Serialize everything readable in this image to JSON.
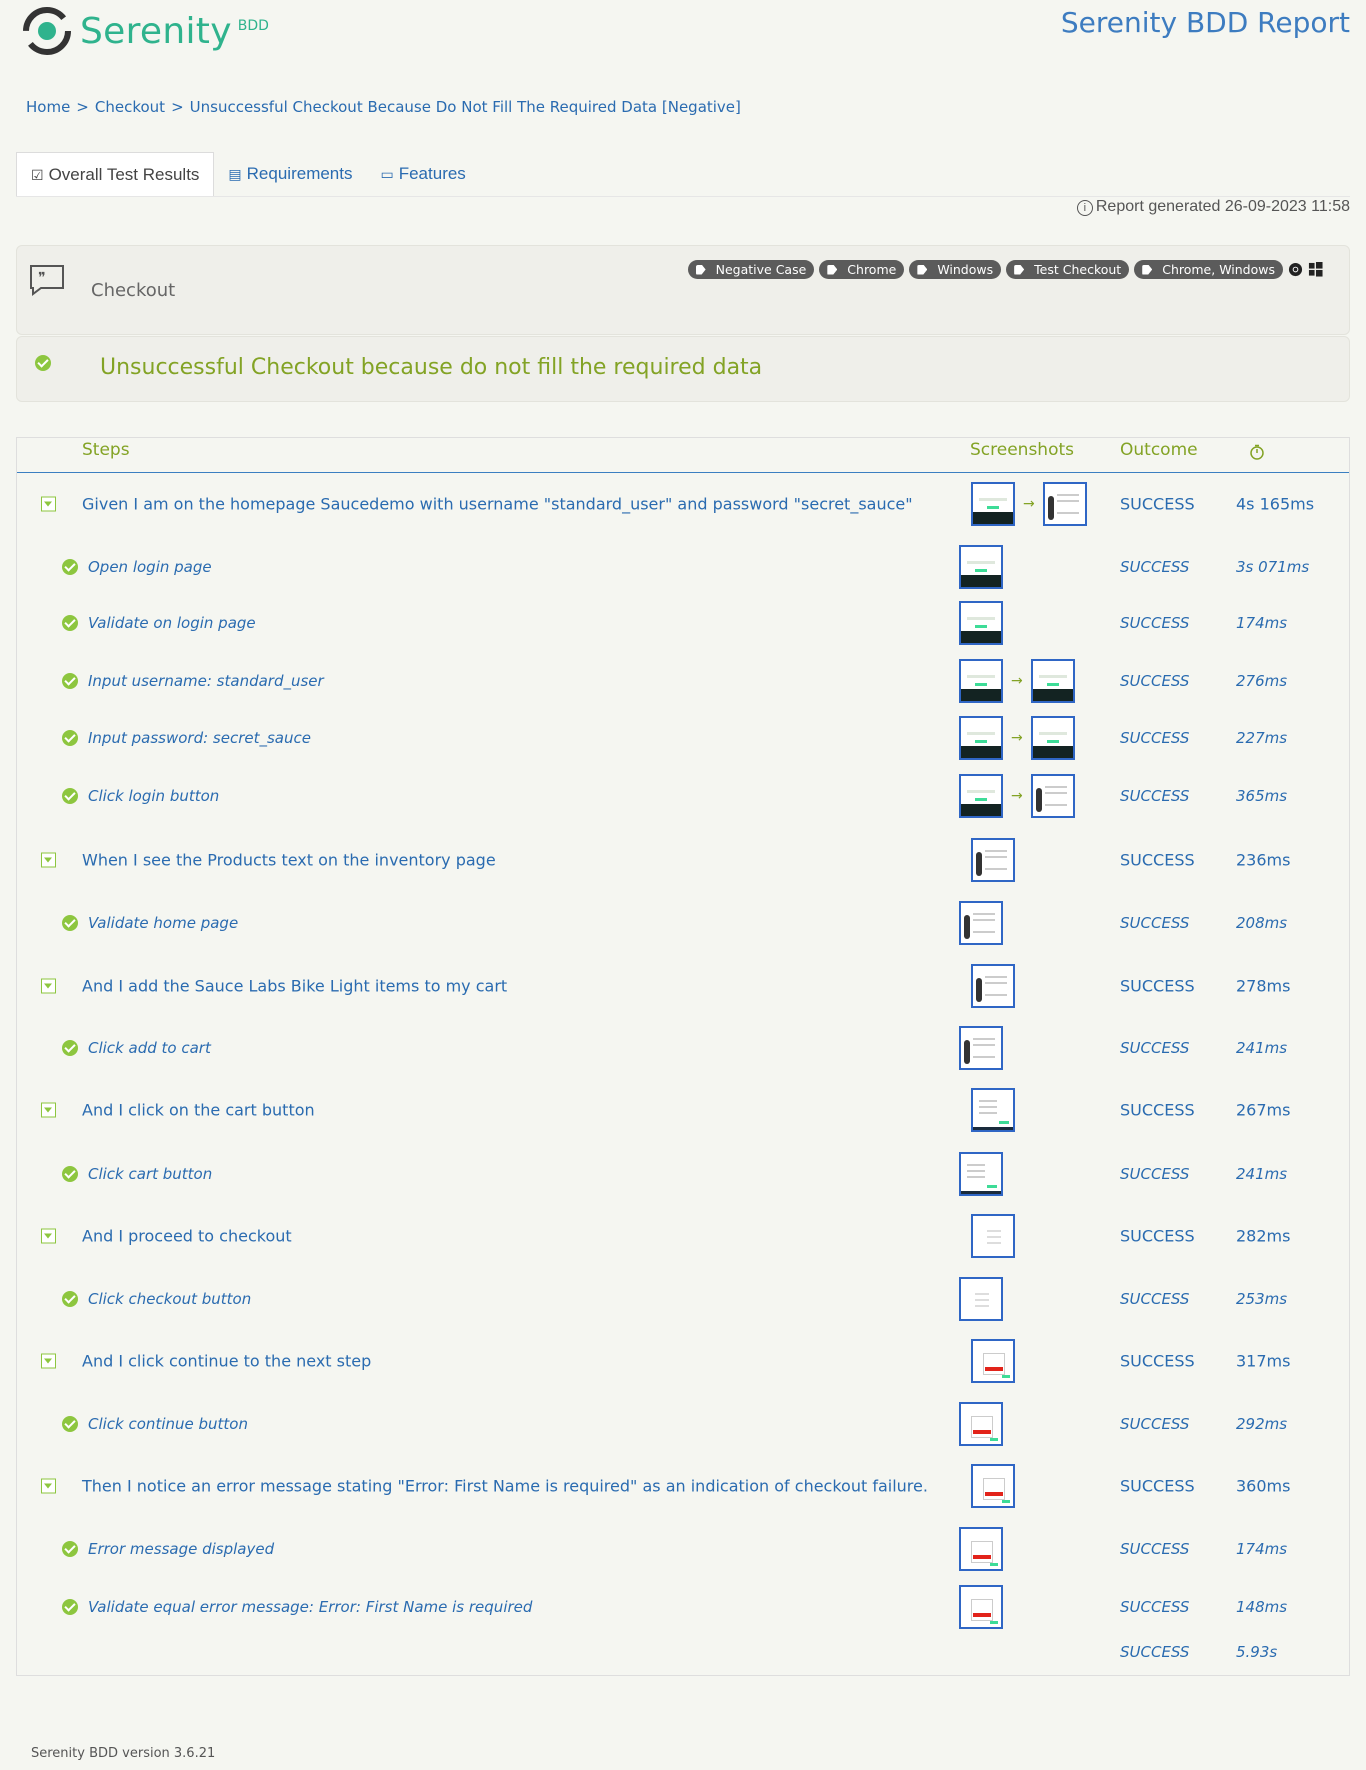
{
  "header": {
    "logo_main": "Serenity",
    "logo_sub": "BDD",
    "report_title": "Serenity BDD Report"
  },
  "breadcrumb": {
    "home": "Home",
    "feature": "Checkout",
    "scenario": "Unsuccessful Checkout Because Do Not Fill The Required Data [Negative]",
    "separator": ">"
  },
  "tabs": [
    {
      "label": "Overall Test Results",
      "icon": "checklist-icon",
      "active": true
    },
    {
      "label": "Requirements",
      "icon": "document-icon",
      "active": false
    },
    {
      "label": "Features",
      "icon": "comment-icon",
      "active": false
    }
  ],
  "report_generated": "Report generated 26-09-2023 11:58",
  "feature": {
    "name": "Checkout",
    "tags": [
      "Negative Case",
      "Chrome",
      "Windows",
      "Test Checkout",
      "Chrome, Windows"
    ]
  },
  "scenario": {
    "title": "Unsuccessful Checkout because do not fill the required data",
    "status": "success"
  },
  "steps_table": {
    "headers": {
      "steps": "Steps",
      "screenshots": "Screenshots",
      "outcome": "Outcome",
      "duration_icon": "stopwatch-icon"
    },
    "rows": [
      {
        "level": "top",
        "text": "Given I am on the homepage Saucedemo with username \"standard_user\" and password \"secret_sauce\"",
        "outcome": "SUCCESS",
        "duration": "4s 165ms",
        "shots": [
          "login",
          "inventory"
        ]
      },
      {
        "level": "sub",
        "text": "Open login page",
        "outcome": "SUCCESS",
        "duration": "3s 071ms",
        "shots": [
          "login"
        ]
      },
      {
        "level": "sub",
        "text": "Validate on login page",
        "outcome": "SUCCESS",
        "duration": "174ms",
        "shots": [
          "login"
        ]
      },
      {
        "level": "sub",
        "text": "Input username: standard_user",
        "outcome": "SUCCESS",
        "duration": "276ms",
        "shots": [
          "login",
          "login"
        ]
      },
      {
        "level": "sub",
        "text": "Input password: secret_sauce",
        "outcome": "SUCCESS",
        "duration": "227ms",
        "shots": [
          "login",
          "login"
        ]
      },
      {
        "level": "sub",
        "text": "Click login button",
        "outcome": "SUCCESS",
        "duration": "365ms",
        "shots": [
          "login",
          "inventory"
        ]
      },
      {
        "level": "top",
        "text": "When I see the Products text on the inventory page",
        "outcome": "SUCCESS",
        "duration": "236ms",
        "shots": [
          "inventory"
        ]
      },
      {
        "level": "sub",
        "text": "Validate home page",
        "outcome": "SUCCESS",
        "duration": "208ms",
        "shots": [
          "inventory"
        ]
      },
      {
        "level": "top",
        "text": "And I add the Sauce Labs Bike Light items to my cart",
        "outcome": "SUCCESS",
        "duration": "278ms",
        "shots": [
          "inventory"
        ]
      },
      {
        "level": "sub",
        "text": "Click add to cart",
        "outcome": "SUCCESS",
        "duration": "241ms",
        "shots": [
          "inventory"
        ]
      },
      {
        "level": "top",
        "text": "And I click on the cart button",
        "outcome": "SUCCESS",
        "duration": "267ms",
        "shots": [
          "cart"
        ]
      },
      {
        "level": "sub",
        "text": "Click cart button",
        "outcome": "SUCCESS",
        "duration": "241ms",
        "shots": [
          "cart"
        ]
      },
      {
        "level": "top",
        "text": "And I proceed to checkout",
        "outcome": "SUCCESS",
        "duration": "282ms",
        "shots": [
          "checkout"
        ]
      },
      {
        "level": "sub",
        "text": "Click checkout button",
        "outcome": "SUCCESS",
        "duration": "253ms",
        "shots": [
          "checkout"
        ]
      },
      {
        "level": "top",
        "text": "And I click continue to the next step",
        "outcome": "SUCCESS",
        "duration": "317ms",
        "shots": [
          "error"
        ]
      },
      {
        "level": "sub",
        "text": "Click continue button",
        "outcome": "SUCCESS",
        "duration": "292ms",
        "shots": [
          "error"
        ]
      },
      {
        "level": "top",
        "text": "Then I notice an error message stating \"Error: First Name is required\" as an indication of checkout failure.",
        "outcome": "SUCCESS",
        "duration": "360ms",
        "shots": [
          "error"
        ]
      },
      {
        "level": "sub",
        "text": "Error message displayed",
        "outcome": "SUCCESS",
        "duration": "174ms",
        "shots": [
          "error"
        ]
      },
      {
        "level": "sub",
        "text": "Validate equal error message: Error: First Name is required",
        "outcome": "SUCCESS",
        "duration": "148ms",
        "shots": [
          "error"
        ]
      }
    ],
    "total": {
      "outcome": "SUCCESS",
      "duration": "5.93s"
    }
  },
  "footer": "Serenity BDD version 3.6.21",
  "colors": {
    "accent_green": "#83a325",
    "success_green": "#8dc63f",
    "link_blue": "#2a6bb0",
    "brand_teal": "#2fb38d",
    "tag_grey": "#5b5b5b"
  }
}
